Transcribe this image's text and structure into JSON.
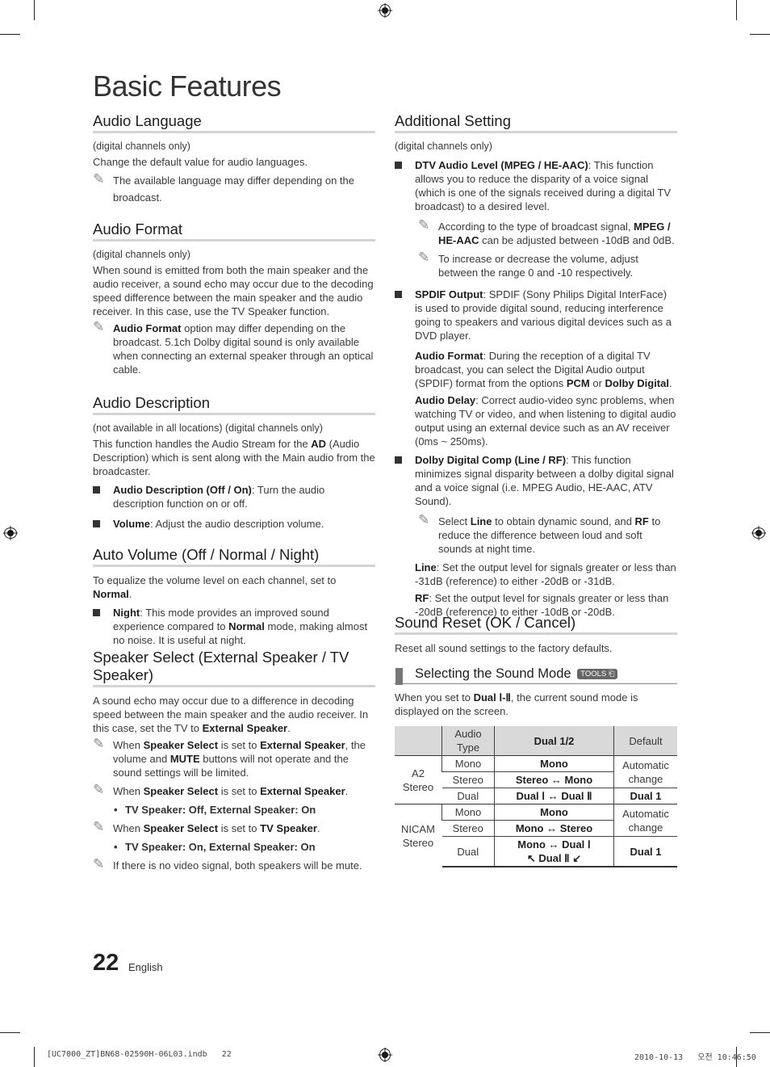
{
  "page_title": "Basic Features",
  "left": {
    "audio_language": {
      "title": "Audio Language",
      "scope": "(digital channels only)",
      "desc": "Change the default value for audio languages.",
      "note": "The available language may differ depending on the broadcast."
    },
    "audio_format": {
      "title": "Audio Format",
      "scope": "(digital channels only)",
      "desc": "When sound is emitted from both the main speaker and the audio receiver, a sound echo may occur due to the decoding speed difference between the main speaker and the audio receiver. In this case, use the TV Speaker function.",
      "note_bold": "Audio Format",
      "note_rest": " option may differ depending on the broadcast. 5.1ch Dolby digital sound is only available when connecting an external speaker through an optical cable."
    },
    "audio_description": {
      "title": "Audio Description",
      "scope": "(not available in all locations) (digital channels only)",
      "desc_a": "This function handles the Audio Stream for the ",
      "desc_b": "AD",
      "desc_c": " (Audio Description) which is sent along with the Main audio from the broadcaster.",
      "items": [
        {
          "bold": "Audio Description (Off / On)",
          "text": ": Turn the audio description function on or off."
        },
        {
          "bold": "Volume",
          "text": ": Adjust the audio description volume."
        }
      ]
    },
    "auto_volume": {
      "title": "Auto Volume (Off / Normal / Night)",
      "desc_a": "To equalize the volume level on each channel, set to ",
      "desc_b": "Normal",
      "desc_c": ".",
      "item_bold": "Night",
      "item_a": ": This mode provides an improved sound experience compared to ",
      "item_b": "Normal",
      "item_c": " mode, making almost no noise. It is useful at night."
    },
    "speaker_select": {
      "title": "Speaker Select (External Speaker / TV Speaker)",
      "desc_a": "A sound echo may occur due to a difference in decoding speed between the main speaker and the audio receiver. In this case, set the TV to ",
      "desc_b": "External Speaker",
      "desc_c": ".",
      "note1": {
        "a": "When ",
        "b": "Speaker Select",
        "c": " is set to ",
        "d": "External Speaker",
        "e": ", the volume and ",
        "f": "MUTE",
        "g": " buttons will not operate and the sound settings will be limited."
      },
      "note2": {
        "a": "When ",
        "b": "Speaker Select",
        "c": " is set to ",
        "d": "External Speaker",
        "e": "."
      },
      "bullet2": "TV Speaker: Off, External Speaker: On",
      "note3": {
        "a": "When ",
        "b": "Speaker Select",
        "c": " is set to ",
        "d": "TV Speaker",
        "e": "."
      },
      "bullet3": "TV Speaker: On, External Speaker: On",
      "note4": "If there is no video signal, both speakers will be mute."
    }
  },
  "right": {
    "additional_setting": {
      "title": "Additional Setting",
      "scope": "(digital channels only)",
      "dtv_bold": "DTV Audio Level (MPEG / HE-AAC)",
      "dtv_text": ": This function allows you to reduce the disparity of a voice signal (which is one of the signals received during a digital TV broadcast) to a desired level.",
      "dtv_note1_a": "According to the type of broadcast signal, ",
      "dtv_note1_b": "MPEG / HE-AAC",
      "dtv_note1_c": " can be adjusted between -10dB and 0dB.",
      "dtv_note2": "To increase or decrease the volume, adjust between the range 0 and -10 respectively.",
      "spdif_bold": "SPDIF Output",
      "spdif_text": ": SPDIF (Sony Philips Digital InterFace) is used to provide digital sound, reducing interference going to speakers and various digital devices such as a DVD player.",
      "af_bold": "Audio Format",
      "af_a": ": During the reception of a digital TV broadcast, you can select the Digital Audio output (SPDIF) format from the options ",
      "af_b": "PCM",
      "af_c": " or ",
      "af_d": "Dolby Digital",
      "af_e": ".",
      "ad_bold": "Audio Delay",
      "ad_text": ": Correct audio-video sync problems, when watching TV or video, and when listening to digital audio output using an external device such as an AV receiver (0ms ~ 250ms).",
      "ddc_bold": "Dolby Digital Comp (Line / RF)",
      "ddc_text": ": This function minimizes signal disparity between a dolby digital signal and a voice signal (i.e. MPEG Audio, HE-AAC, ATV Sound).",
      "ddc_note_a": "Select ",
      "ddc_note_b": "Line",
      "ddc_note_c": " to obtain dynamic sound, and ",
      "ddc_note_d": "RF",
      "ddc_note_e": " to reduce the difference between loud and soft sounds at night time.",
      "line_bold": "Line",
      "line_text": ": Set the output level for signals greater or less than -31dB (reference) to either -20dB or -31dB.",
      "rf_bold": "RF",
      "rf_text": ": Set the output level for signals greater or less than -20dB (reference) to either -10dB or -20dB."
    },
    "sound_reset": {
      "title": "Sound Reset (OK / Cancel)",
      "desc": "Reset all sound settings to the factory defaults."
    },
    "sound_mode": {
      "title": "Selecting the Sound Mode",
      "tools_badge": "TOOLS",
      "desc_a": "When you set to ",
      "desc_b": "Dual Ⅰ-Ⅱ",
      "desc_c": ", the current sound mode is displayed on the screen.",
      "table": {
        "headers": [
          "",
          "Audio Type",
          "Dual 1/2",
          "Default"
        ],
        "groups": [
          {
            "name": "A2 Stereo",
            "rows": [
              {
                "type": "Mono",
                "dual": "Mono"
              },
              {
                "type": "Stereo",
                "dual": "Stereo ↔ Mono"
              },
              {
                "type": "Dual",
                "dual": "Dual Ⅰ ↔ Dual Ⅱ"
              }
            ],
            "default_auto": "Automatic change",
            "default_dual": "Dual 1"
          },
          {
            "name": "NICAM Stereo",
            "rows": [
              {
                "type": "Mono",
                "dual": "Mono"
              },
              {
                "type": "Stereo",
                "dual": "Mono ↔ Stereo"
              },
              {
                "type": "Dual",
                "dual": "Mono ↔ Dual Ⅰ",
                "dual2": "↖ Dual Ⅱ ↙"
              }
            ],
            "default_auto": "Automatic change",
            "default_dual": "Dual 1"
          }
        ]
      }
    }
  },
  "footer": {
    "page_number": "22",
    "language": "English",
    "slug_file": "[UC7000_ZT]BN68-02590H-06L03.indb   22",
    "slug_date": "2010-10-13   오전 10:46:50"
  },
  "icons": {
    "note": "✎"
  }
}
